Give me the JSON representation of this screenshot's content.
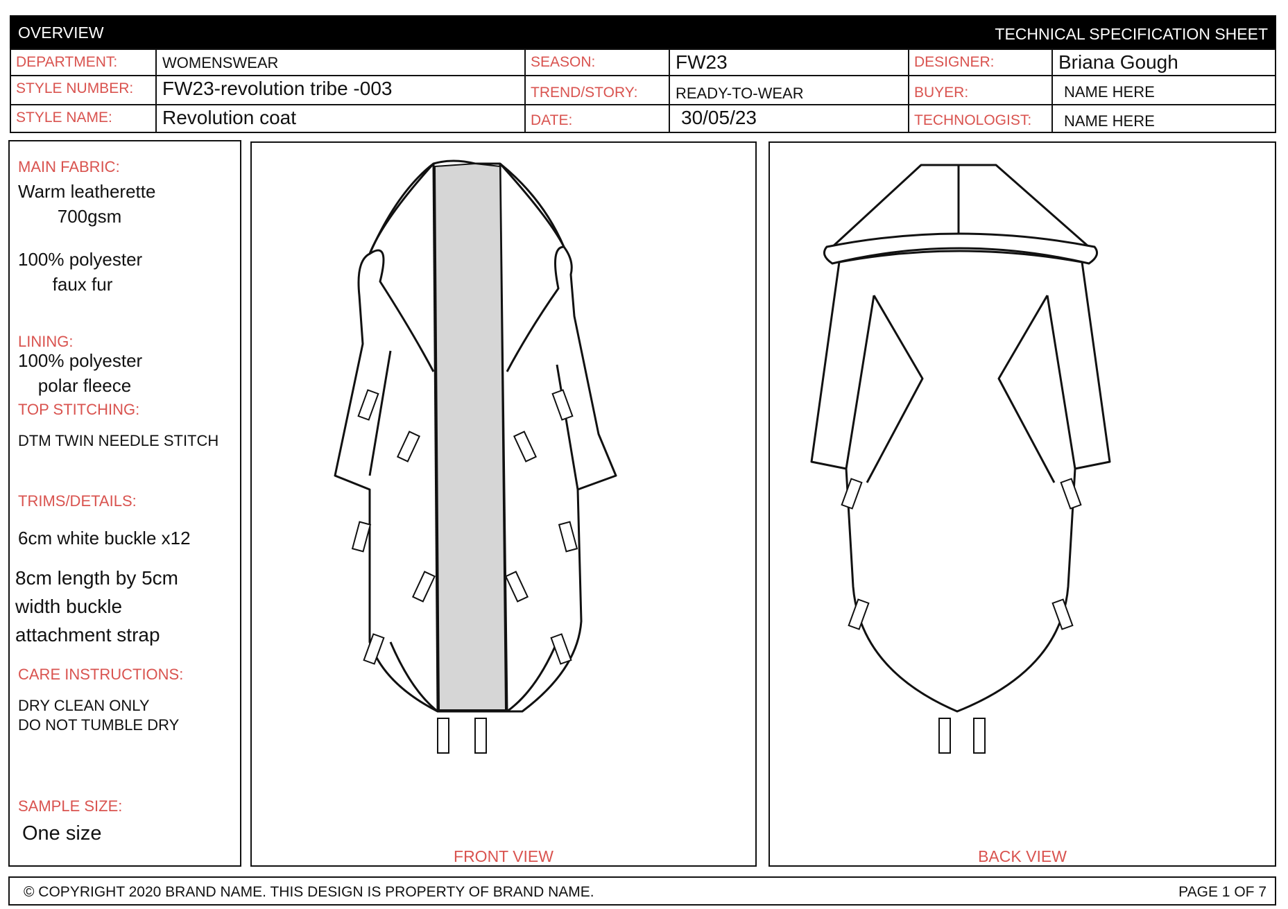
{
  "header": {
    "left_title": "OVERVIEW",
    "right_title": "TECHNICAL SPECIFICATION SHEET"
  },
  "fields": {
    "department": {
      "label": "DEPARTMENT:",
      "value": "WOMENSWEAR"
    },
    "style_number": {
      "label": "STYLE NUMBER:",
      "value": "FW23-revolution tribe -003"
    },
    "style_name": {
      "label": "STYLE NAME:",
      "value": "Revolution coat"
    },
    "season": {
      "label": "SEASON:",
      "value": "FW23"
    },
    "trend_story": {
      "label": "TREND/STORY:",
      "value": "READY-TO-WEAR"
    },
    "date": {
      "label": "DATE:",
      "value": "30/05/23"
    },
    "designer": {
      "label": "DESIGNER:",
      "value": "Briana Gough"
    },
    "buyer": {
      "label": "BUYER:",
      "value": "NAME HERE"
    },
    "technologist": {
      "label": "TECHNOLOGIST:",
      "value": "NAME HERE"
    }
  },
  "specs": {
    "main_fabric_label": "MAIN FABRIC:",
    "main_fabric_1a": "Warm leatherette",
    "main_fabric_1b": "700gsm",
    "main_fabric_2a": "100% polyester",
    "main_fabric_2b": "faux fur",
    "lining_label": "LINING:",
    "lining_a": "100% polyester",
    "lining_b": "polar fleece",
    "top_stitching_label": "TOP STITCHING:",
    "top_stitching": "DTM TWIN NEEDLE STITCH",
    "trims_label": "TRIMS/DETAILS:",
    "trims_1": "6cm white  buckle x12",
    "trims_2a": "8cm length by 5cm",
    "trims_2b": "width buckle",
    "trims_2c": "attachment strap",
    "care_label": "CARE INSTRUCTIONS:",
    "care_1": "DRY CLEAN ONLY",
    "care_2": "DO NOT TUMBLE DRY",
    "sample_size_label": "SAMPLE SIZE:",
    "sample_size": "One size"
  },
  "views": {
    "front_label": "FRONT VIEW",
    "back_label": "BACK VIEW"
  },
  "footer": {
    "copyright": "© COPYRIGHT 2020 BRAND NAME. THIS DESIGN IS PROPERTY OF BRAND NAME.",
    "page": "PAGE 1 OF 7"
  },
  "colors": {
    "label_red": "#d9534f",
    "header_bg": "#000000",
    "placket_grey": "#d6d6d6"
  }
}
